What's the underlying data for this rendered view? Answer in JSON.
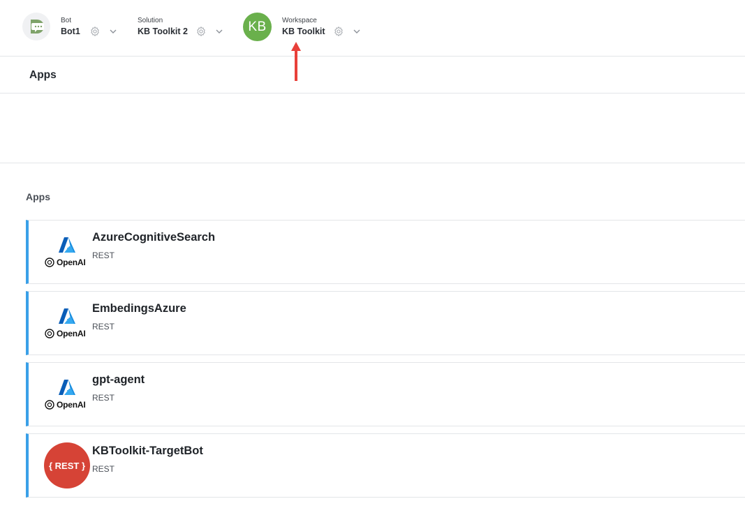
{
  "topbar": {
    "bot": {
      "caption": "Bot",
      "value": "Bot1"
    },
    "solution": {
      "caption": "Solution",
      "value": "KB Toolkit 2"
    },
    "workspace": {
      "caption": "Workspace",
      "value": "KB Toolkit",
      "initials": "KB",
      "avatar_color": "#6ab04c"
    }
  },
  "header": {
    "title": "Apps"
  },
  "section": {
    "label": "Apps"
  },
  "apps": [
    {
      "name": "AzureCognitiveSearch",
      "type": "REST",
      "logo_text": "OpenAI"
    },
    {
      "name": "EmbedingsAzure",
      "type": "REST",
      "logo_text": "OpenAI"
    },
    {
      "name": "gpt-agent",
      "type": "REST",
      "logo_text": "OpenAI"
    },
    {
      "name": "KBToolkit-TargetBot",
      "type": "REST",
      "logo_text": "{ REST }"
    }
  ],
  "colors": {
    "accent": "#3aa0e8",
    "rest_logo": "#d64336",
    "arrow": "#e8403a"
  }
}
